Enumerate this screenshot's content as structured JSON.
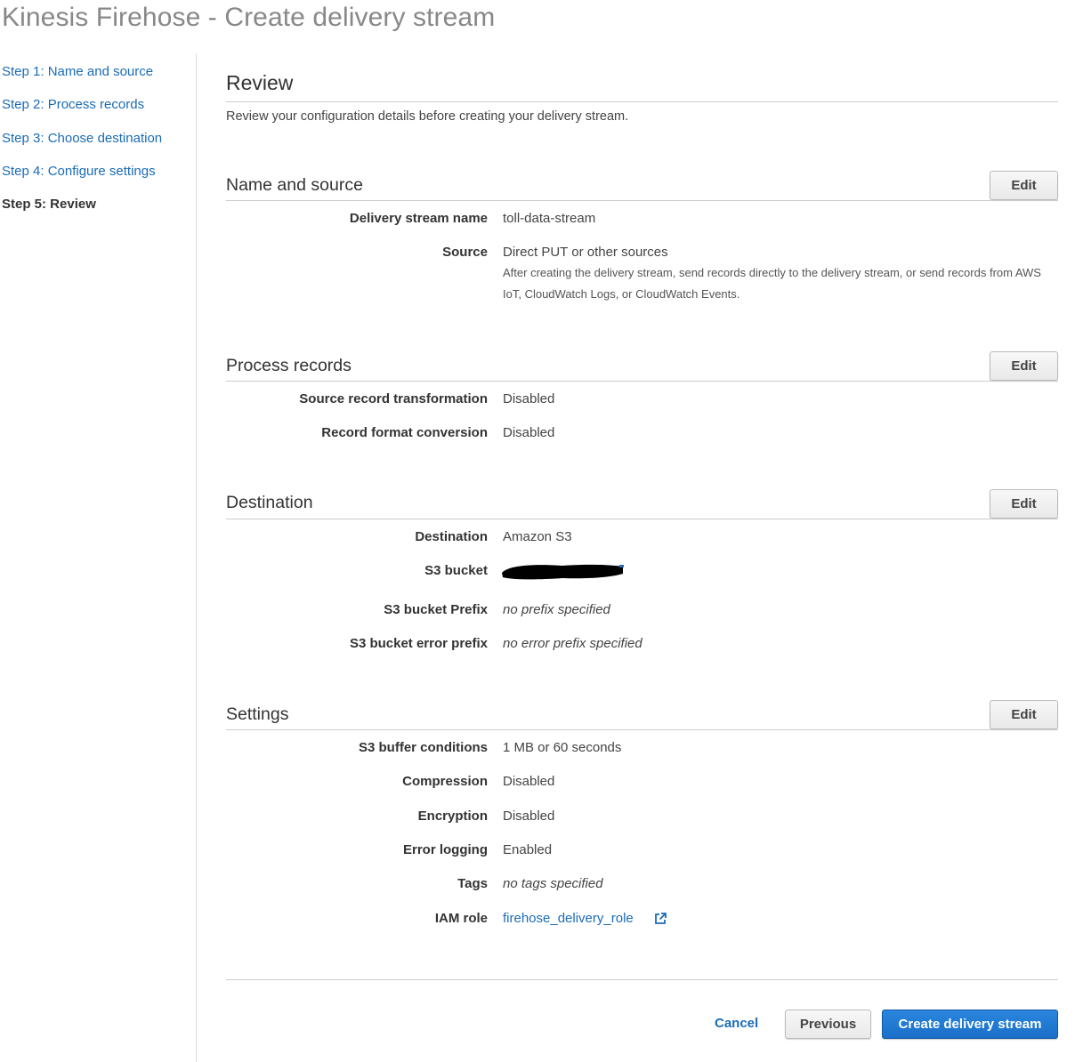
{
  "header": {
    "title": "Kinesis Firehose - Create delivery stream"
  },
  "steps": [
    {
      "label": "Step 1: Name and source"
    },
    {
      "label": "Step 2: Process records"
    },
    {
      "label": "Step 3: Choose destination"
    },
    {
      "label": "Step 4: Configure settings"
    },
    {
      "label": "Step 5: Review",
      "current": true
    }
  ],
  "review": {
    "title": "Review",
    "description": "Review your configuration details before creating your delivery stream."
  },
  "sections": {
    "name_source": {
      "title": "Name and source",
      "edit_label": "Edit",
      "rows": [
        {
          "label": "Delivery stream name",
          "value": "toll-data-stream"
        },
        {
          "label": "Source",
          "value": "Direct PUT or other sources",
          "help": "After creating the delivery stream, send records directly to the delivery stream, or send records from AWS IoT, CloudWatch Logs, or CloudWatch Events."
        }
      ]
    },
    "process_records": {
      "title": "Process records",
      "edit_label": "Edit",
      "rows": [
        {
          "label": "Source record transformation",
          "value": "Disabled"
        },
        {
          "label": "Record format conversion",
          "value": "Disabled"
        }
      ]
    },
    "destination": {
      "title": "Destination",
      "edit_label": "Edit",
      "rows": [
        {
          "label": "Destination",
          "value": "Amazon S3"
        },
        {
          "label": "S3 bucket",
          "value": ""
        },
        {
          "label": "S3 bucket Prefix",
          "value": "no prefix specified"
        },
        {
          "label": "S3 bucket error prefix",
          "value": "no error prefix specified"
        }
      ]
    },
    "settings": {
      "title": "Settings",
      "edit_label": "Edit",
      "rows": [
        {
          "label": "S3 buffer conditions",
          "value": "1 MB or 60 seconds"
        },
        {
          "label": "Compression",
          "value": "Disabled"
        },
        {
          "label": "Encryption",
          "value": "Disabled"
        },
        {
          "label": "Error logging",
          "value": "Enabled"
        },
        {
          "label": "Tags",
          "value": "no tags specified"
        },
        {
          "label": "IAM role",
          "value": "firehose_delivery_role"
        }
      ]
    }
  },
  "footer": {
    "cancel_label": "Cancel",
    "previous_label": "Previous",
    "create_label": "Create delivery stream"
  },
  "colors": {
    "link": "#1a6bb8",
    "primary_button": "#1f78d1",
    "title_gray": "#888888"
  }
}
